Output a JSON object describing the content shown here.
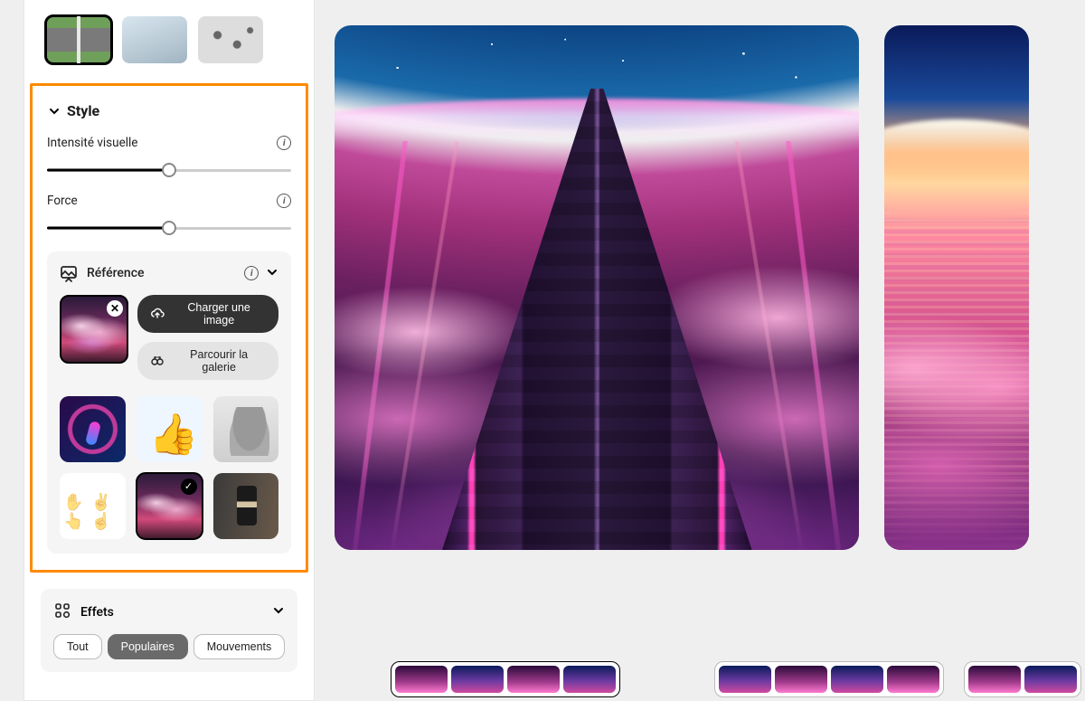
{
  "top_thumbs": [
    "road",
    "building",
    "pattern"
  ],
  "style": {
    "title": "Style",
    "visual_intensity_label": "Intensité visuelle",
    "visual_intensity_percent": 50,
    "force_label": "Force",
    "force_percent": 50
  },
  "reference": {
    "title": "Référence",
    "upload_label": "Charger une image",
    "browse_label": "Parcourir la galerie",
    "gallery_items": [
      {
        "name": "neon-figure",
        "selected": false
      },
      {
        "name": "thumbs-up-3d",
        "selected": false
      },
      {
        "name": "classical-bust",
        "selected": false
      },
      {
        "name": "hand-sketches",
        "selected": false
      },
      {
        "name": "pink-clouds",
        "selected": true
      },
      {
        "name": "man-room",
        "selected": false
      }
    ]
  },
  "effects": {
    "title": "Effets",
    "tabs": [
      {
        "label": "Tout",
        "active": false
      },
      {
        "label": "Populaires",
        "active": true
      },
      {
        "label": "Mouvements",
        "active": false
      }
    ]
  },
  "colors": {
    "highlight": "#ff8a00",
    "accent_pink": "#d14a7a"
  }
}
